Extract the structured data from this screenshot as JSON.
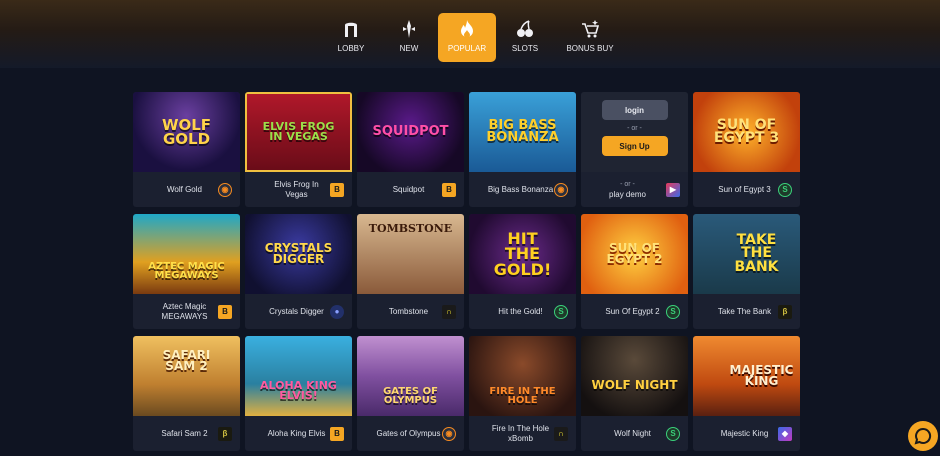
{
  "nav": {
    "items": [
      {
        "label": "LOBBY",
        "icon": "lobby-icon"
      },
      {
        "label": "NEW",
        "icon": "new-icon"
      },
      {
        "label": "POPULAR",
        "icon": "flame-icon"
      },
      {
        "label": "SLOTS",
        "icon": "cherries-icon"
      },
      {
        "label": "BONUS BUY",
        "icon": "bonus-buy-icon"
      }
    ],
    "selected": "POPULAR"
  },
  "colors": {
    "accent": "#f5a623",
    "card_bg": "#1b2030",
    "page_bg": "#0f1422"
  },
  "demo_card": {
    "login_label": "login",
    "or_label": "- or -",
    "signup_label": "Sign Up",
    "or_label2": "- or -",
    "play_demo_label": "play demo"
  },
  "games": [
    {
      "name": "Wolf Gold",
      "logo": "WOLF GOLD",
      "provider": "pragmatic"
    },
    {
      "name": "Elvis Frog In Vegas",
      "logo": "ELVIS FROG IN VEGAS",
      "provider": "bgaming"
    },
    {
      "name": "Squidpot",
      "logo": "SQUIDPOT",
      "provider": "bgaming"
    },
    {
      "name": "Big Bass Bonanza",
      "logo": "BIG BASS BONANZA",
      "provider": "pragmatic"
    },
    {
      "name": "Sun of Egypt 3",
      "logo": "SUN OF EGYPT 3",
      "provider": "booongo"
    },
    {
      "name": "Aztec Magic MEGAWAYS",
      "logo": "AZTEC MAGIC MEGAWAYS",
      "provider": "bgaming"
    },
    {
      "name": "Crystals Digger",
      "logo": "CRYSTALS DIGGER",
      "provider": "other"
    },
    {
      "name": "Tombstone",
      "logo": "TOMBSTONE",
      "provider": "nolimit"
    },
    {
      "name": "Hit the Gold!",
      "logo": "HIT THE GOLD!",
      "provider": "booongo"
    },
    {
      "name": "Sun Of Egypt 2",
      "logo": "SUN OF EGYPT 2",
      "provider": "booongo"
    },
    {
      "name": "Take The Bank",
      "logo": "TAKE THE BANK",
      "provider": "betsoft"
    },
    {
      "name": "Safari Sam 2",
      "logo": "SAFARI SAM 2",
      "provider": "betsoft"
    },
    {
      "name": "Aloha King Elvis",
      "logo": "ALOHA KING ELVIS!",
      "provider": "bgaming"
    },
    {
      "name": "Gates of Olympus",
      "logo": "GATES OF OLYMPUS",
      "provider": "pragmatic"
    },
    {
      "name": "Fire In The Hole xBomb",
      "logo": "FIRE IN THE HOLE",
      "provider": "nolimit"
    },
    {
      "name": "Wolf Night",
      "logo": "WOLF NIGHT",
      "provider": "booongo"
    },
    {
      "name": "Majestic King",
      "logo": "MAJESTIC KING",
      "provider": "other2"
    }
  ]
}
